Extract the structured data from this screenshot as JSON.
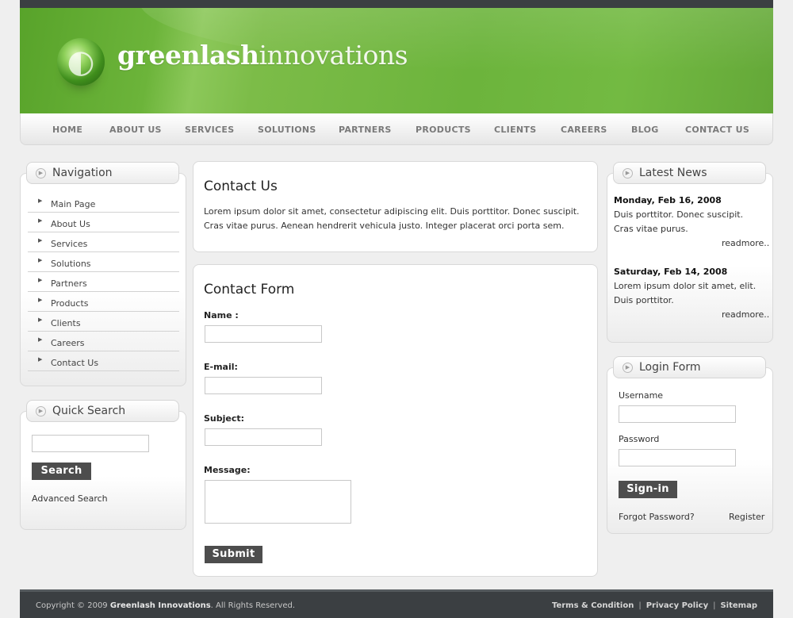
{
  "brand": {
    "bold": "greenlash",
    "light": "innovations"
  },
  "nav": [
    "HOME",
    "ABOUT US",
    "SERVICES",
    "SOLUTIONS",
    "PARTNERS",
    "PRODUCTS",
    "CLIENTS",
    "CAREERS",
    "BLOG",
    "CONTACT US"
  ],
  "sidebar": {
    "title": "Navigation",
    "items": [
      "Main Page",
      "About Us",
      "Services",
      "Solutions",
      "Partners",
      "Products",
      "Clients",
      "Careers",
      "Contact Us"
    ]
  },
  "quick_search": {
    "title": "Quick Search",
    "button": "Search",
    "advanced": "Advanced Search"
  },
  "contact": {
    "title": "Contact Us",
    "text": "Lorem ipsum dolor sit amet, consectetur adipiscing elit. Duis porttitor. Donec suscipit. Cras vitae purus. Aenean hendrerit vehicula justo. Integer placerat orci porta sem."
  },
  "form": {
    "title": "Contact Form",
    "name_label": "Name :",
    "email_label": "E-mail:",
    "subject_label": "Subject:",
    "message_label": "Message:",
    "submit": "Submit"
  },
  "news": {
    "title": "Latest News",
    "items": [
      {
        "date": "Monday, Feb 16, 2008",
        "text": "Duis porttitor. Donec suscipit. Cras vitae purus.",
        "more": "readmore.."
      },
      {
        "date": "Saturday, Feb 14, 2008",
        "text": "Lorem ipsum dolor sit amet, elit. Duis porttitor.",
        "more": "readmore.."
      }
    ]
  },
  "login": {
    "title": "Login Form",
    "username_label": "Username",
    "password_label": "Password",
    "signin": "Sign-in",
    "forgot": "Forgot Password?",
    "register": "Register"
  },
  "footer": {
    "copyright_prefix": "Copyright © 2009",
    "company": "Greenlash Innovations",
    "copyright_suffix": ". All Rights Reserved.",
    "links": [
      "Terms & Condition",
      "Privacy Policy",
      "Sitemap"
    ]
  }
}
